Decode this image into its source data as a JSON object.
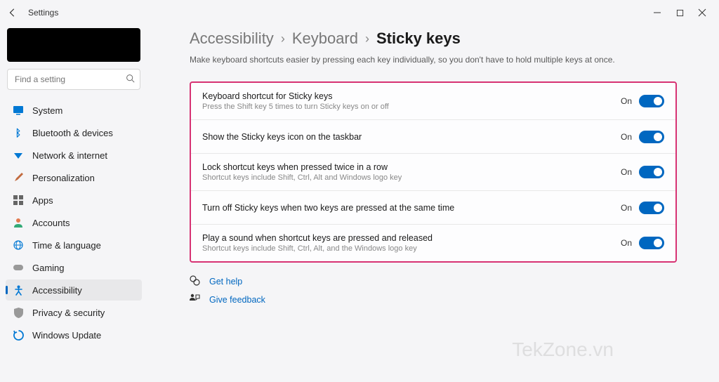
{
  "window": {
    "title": "Settings"
  },
  "sidebar": {
    "search_placeholder": "Find a setting",
    "items": [
      {
        "label": "System",
        "icon_color": "#0078d4",
        "icon": "▭"
      },
      {
        "label": "Bluetooth & devices",
        "icon_color": "#0078d4",
        "icon": "ᛒ"
      },
      {
        "label": "Network & internet",
        "icon_color": "#0078d4",
        "icon": "◈"
      },
      {
        "label": "Personalization",
        "icon_color": "#c26a3e",
        "icon": "✎"
      },
      {
        "label": "Apps",
        "icon_color": "#555",
        "icon": "▦"
      },
      {
        "label": "Accounts",
        "icon_color": "#e27a4f",
        "icon": "●"
      },
      {
        "label": "Time & language",
        "icon_color": "#0078d4",
        "icon": "🌐"
      },
      {
        "label": "Gaming",
        "icon_color": "#888",
        "icon": "🎮"
      },
      {
        "label": "Accessibility",
        "icon_color": "#0078d4",
        "icon": "✶",
        "active": true
      },
      {
        "label": "Privacy & security",
        "icon_color": "#888",
        "icon": "🛡"
      },
      {
        "label": "Windows Update",
        "icon_color": "#0078d4",
        "icon": "⟳"
      }
    ]
  },
  "breadcrumb": {
    "parts": [
      "Accessibility",
      "Keyboard"
    ],
    "current": "Sticky keys"
  },
  "page_description": "Make keyboard shortcuts easier by pressing each key individually, so you don't have to hold multiple keys at once.",
  "settings": [
    {
      "title": "Keyboard shortcut for Sticky keys",
      "sub": "Press the Shift key 5 times to turn Sticky keys on or off",
      "state": "On"
    },
    {
      "title": "Show the Sticky keys icon on the taskbar",
      "sub": "",
      "state": "On"
    },
    {
      "title": "Lock shortcut keys when pressed twice in a row",
      "sub": "Shortcut keys include Shift, Ctrl, Alt and Windows logo key",
      "state": "On"
    },
    {
      "title": "Turn off Sticky keys when two keys are pressed at the same time",
      "sub": "",
      "state": "On"
    },
    {
      "title": "Play a sound when shortcut keys are pressed and released",
      "sub": "Shortcut keys include Shift, Ctrl, Alt, and the Windows logo key",
      "state": "On"
    }
  ],
  "links": {
    "help": "Get help",
    "feedback": "Give feedback"
  },
  "watermark": "TekZone.vn"
}
